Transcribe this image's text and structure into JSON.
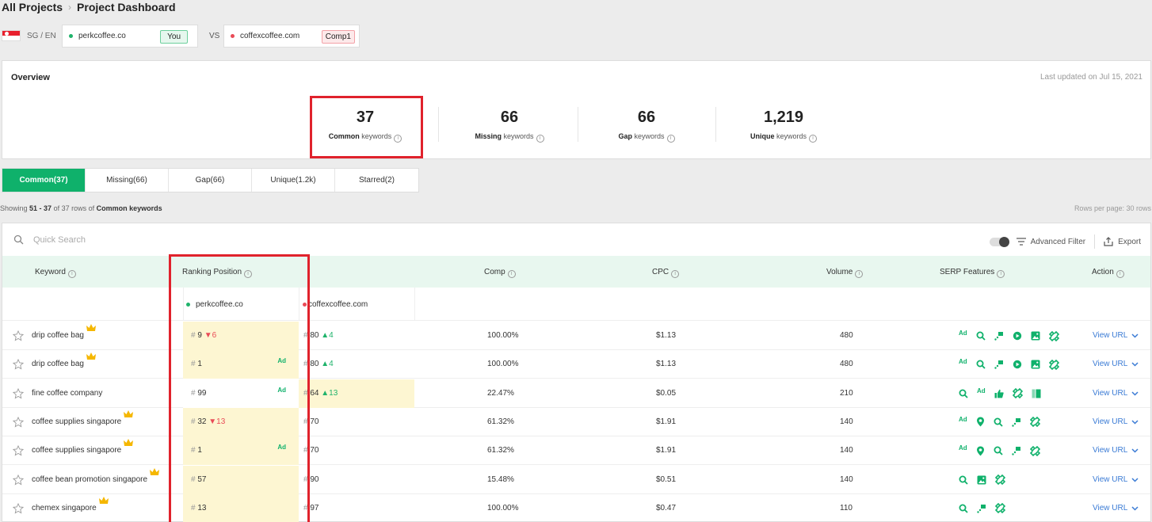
{
  "breadcrumb": {
    "root": "All Projects",
    "current": "Project Dashboard"
  },
  "locale": "SG / EN",
  "you": {
    "domain": "perkcoffee.co",
    "tag": "You"
  },
  "vs": "VS",
  "comp": {
    "domain": "coffexcoffee.com",
    "tag": "Comp1"
  },
  "overview": {
    "title": "Overview",
    "updated": "Last updated on Jul 15, 2021",
    "stats": [
      {
        "num": "37",
        "bold": "Common",
        "rest": " keywords"
      },
      {
        "num": "66",
        "bold": "Missing",
        "rest": " keywords"
      },
      {
        "num": "66",
        "bold": "Gap",
        "rest": " keywords"
      },
      {
        "num": "1,219",
        "bold": "Unique",
        "rest": " keywords"
      }
    ]
  },
  "tabs": [
    "Common(37)",
    "Missing(66)",
    "Gap(66)",
    "Unique(1.2k)",
    "Starred(2)"
  ],
  "showing": {
    "prefix": "Showing ",
    "range": "51 - 37",
    "middle": " of 37 rows of ",
    "type": "Common keywords"
  },
  "rows_per_page": "Rows per page: 30 rows",
  "search_placeholder": "Quick Search",
  "toolbar": {
    "advanced_filter": "Advanced Filter",
    "export": "Export"
  },
  "columns": {
    "keyword": "Keyword",
    "ranking": "Ranking Position",
    "comp": "Comp",
    "cpc": "CPC",
    "volume": "Volume",
    "serp": "SERP Features",
    "action": "Action"
  },
  "subcols": {
    "you": "perkcoffee.co",
    "comp": "coffexcoffee.com"
  },
  "rows": [
    {
      "keyword": "drip coffee bag",
      "crown": true,
      "p1": "9",
      "p1_delta": "▼6",
      "p1_ad": "",
      "p2": "80",
      "p2_delta": "▲4",
      "comp": "100.00%",
      "cpc": "$1.13",
      "volume": "480",
      "action": "View URL"
    },
    {
      "keyword": "drip coffee bag",
      "crown": true,
      "p1": "1",
      "p1_delta": "",
      "p1_ad": "Ad",
      "p2": "80",
      "p2_delta": "▲4",
      "comp": "100.00%",
      "cpc": "$1.13",
      "volume": "480",
      "action": "View URL"
    },
    {
      "keyword": "fine coffee company",
      "crown": false,
      "p1": "99",
      "p1_delta": "",
      "p1_ad": "Ad",
      "p2": "64",
      "p2_delta": "▲13",
      "comp": "22.47%",
      "cpc": "$0.05",
      "volume": "210",
      "action": "View URL"
    },
    {
      "keyword": "coffee supplies singapore",
      "crown": true,
      "p1": "32",
      "p1_delta": "▼13",
      "p1_ad": "",
      "p2": "70",
      "p2_delta": "",
      "comp": "61.32%",
      "cpc": "$1.91",
      "volume": "140",
      "action": "View URL"
    },
    {
      "keyword": "coffee supplies singapore",
      "crown": true,
      "p1": "1",
      "p1_delta": "",
      "p1_ad": "Ad",
      "p2": "70",
      "p2_delta": "",
      "comp": "61.32%",
      "cpc": "$1.91",
      "volume": "140",
      "action": "View URL"
    },
    {
      "keyword": "coffee bean promotion singapore",
      "crown": true,
      "p1": "57",
      "p1_delta": "",
      "p1_ad": "",
      "p2": "90",
      "p2_delta": "",
      "comp": "15.48%",
      "cpc": "$0.51",
      "volume": "140",
      "action": "View URL"
    },
    {
      "keyword": "chemex singapore",
      "crown": true,
      "p1": "13",
      "p1_delta": "",
      "p1_ad": "",
      "p2": "97",
      "p2_delta": "",
      "comp": "100.00%",
      "cpc": "$0.47",
      "volume": "110",
      "action": "View URL"
    }
  ],
  "serp_ad_label": "Ad",
  "colors": {
    "accent": "#0fb16b",
    "highlight": "#e0222c",
    "up": "#1fb36b",
    "down": "#e94b57",
    "link": "#3a7bd5"
  }
}
